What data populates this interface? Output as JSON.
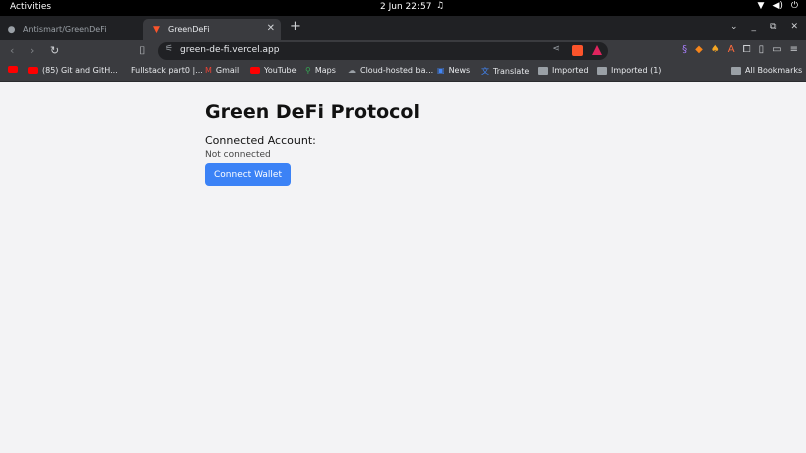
{
  "system": {
    "activities": "Activities",
    "clock": "2 Jun  22:57"
  },
  "tabs": [
    {
      "label": "Antismart/GreenDeFi",
      "active": false
    },
    {
      "label": "GreenDeFi",
      "active": true
    }
  ],
  "omnibox": {
    "url": "green-de-fi.vercel.app"
  },
  "bookmarks": [
    {
      "label": "(85) Git and GitH...",
      "icon": "youtube-icon"
    },
    {
      "label": "Fullstack part0 |...",
      "icon": "none"
    },
    {
      "label": "Gmail",
      "icon": "gmail-icon"
    },
    {
      "label": "YouTube",
      "icon": "youtube-icon"
    },
    {
      "label": "Maps",
      "icon": "maps-icon"
    },
    {
      "label": "Cloud-hosted ba...",
      "icon": "cloud-icon"
    },
    {
      "label": "News",
      "icon": "news-icon"
    },
    {
      "label": "Translate",
      "icon": "translate-icon"
    },
    {
      "label": "Imported",
      "icon": "folder-icon"
    },
    {
      "label": "Imported (1)",
      "icon": "folder-icon"
    },
    {
      "label": "All Bookmarks",
      "icon": "folder-icon"
    }
  ],
  "page": {
    "title": "Green DeFi Protocol",
    "account_label": "Connected Account:",
    "account_value": "Not connected",
    "connect_button": "Connect Wallet"
  },
  "colors": {
    "accent": "#3b82f6",
    "page_bg": "#f3f3f5",
    "chrome_bg": "#3a3b3f"
  }
}
